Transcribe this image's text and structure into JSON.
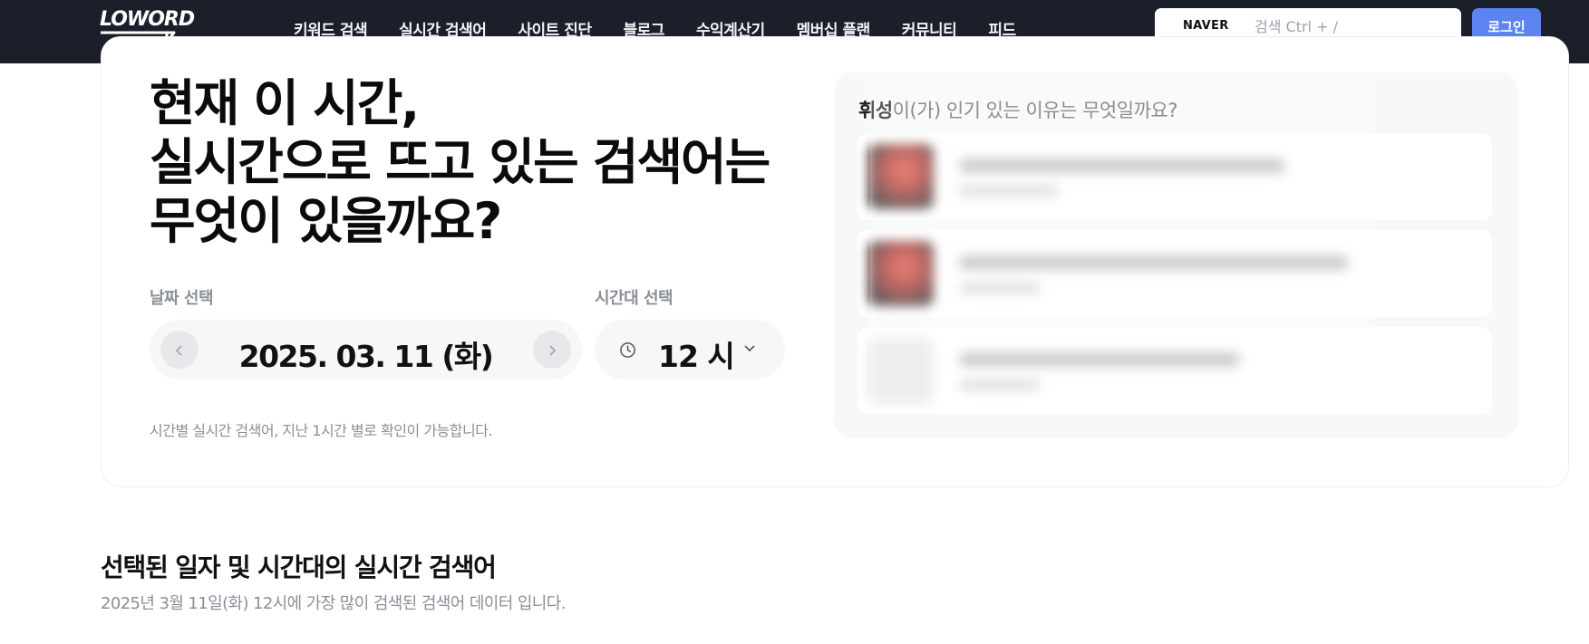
{
  "header": {
    "logo_text": "LOWORD",
    "nav": [
      {
        "label": "키워드 검색"
      },
      {
        "label": "실시간 검색어"
      },
      {
        "label": "사이트 진단"
      },
      {
        "label": "블로그"
      },
      {
        "label": "수익계산기"
      },
      {
        "label": "멤버십 플랜"
      },
      {
        "label": "커뮤니티"
      },
      {
        "label": "피드"
      }
    ],
    "search": {
      "engine": "NAVER",
      "placeholder": "검색 Ctrl + /"
    },
    "login_label": "로그인"
  },
  "hero": {
    "title": "현재 이 시간,\n실시간으로 뜨고 있는 검색어는\n무엇이 있을까요?"
  },
  "date_picker": {
    "label": "날짜 선택",
    "value": "2025. 03. 11 (화)",
    "prev_icon": "chevron-left-icon",
    "next_icon": "chevron-right-icon"
  },
  "time_picker": {
    "label": "시간대 선택",
    "value": "12 시",
    "icon": "clock-icon"
  },
  "helper_text": "시간별 실시간 검색어, 지난 1시간 별로 확인이 가능합니다.",
  "reason_panel": {
    "keyword": "휘성",
    "question": "이(가) 인기 있는 이유는 무엇일까요?"
  },
  "section": {
    "title": "선택된 일자 및 시간대의 실시간 검색어",
    "subtitle": "2025년 3월 11일(화) 12시에 가장 많이 검색된 검색어 데이터 입니다."
  },
  "colors": {
    "topbar": "#1b1f2a",
    "accent": "#5b84f0",
    "muted_text": "#8a8f98"
  }
}
